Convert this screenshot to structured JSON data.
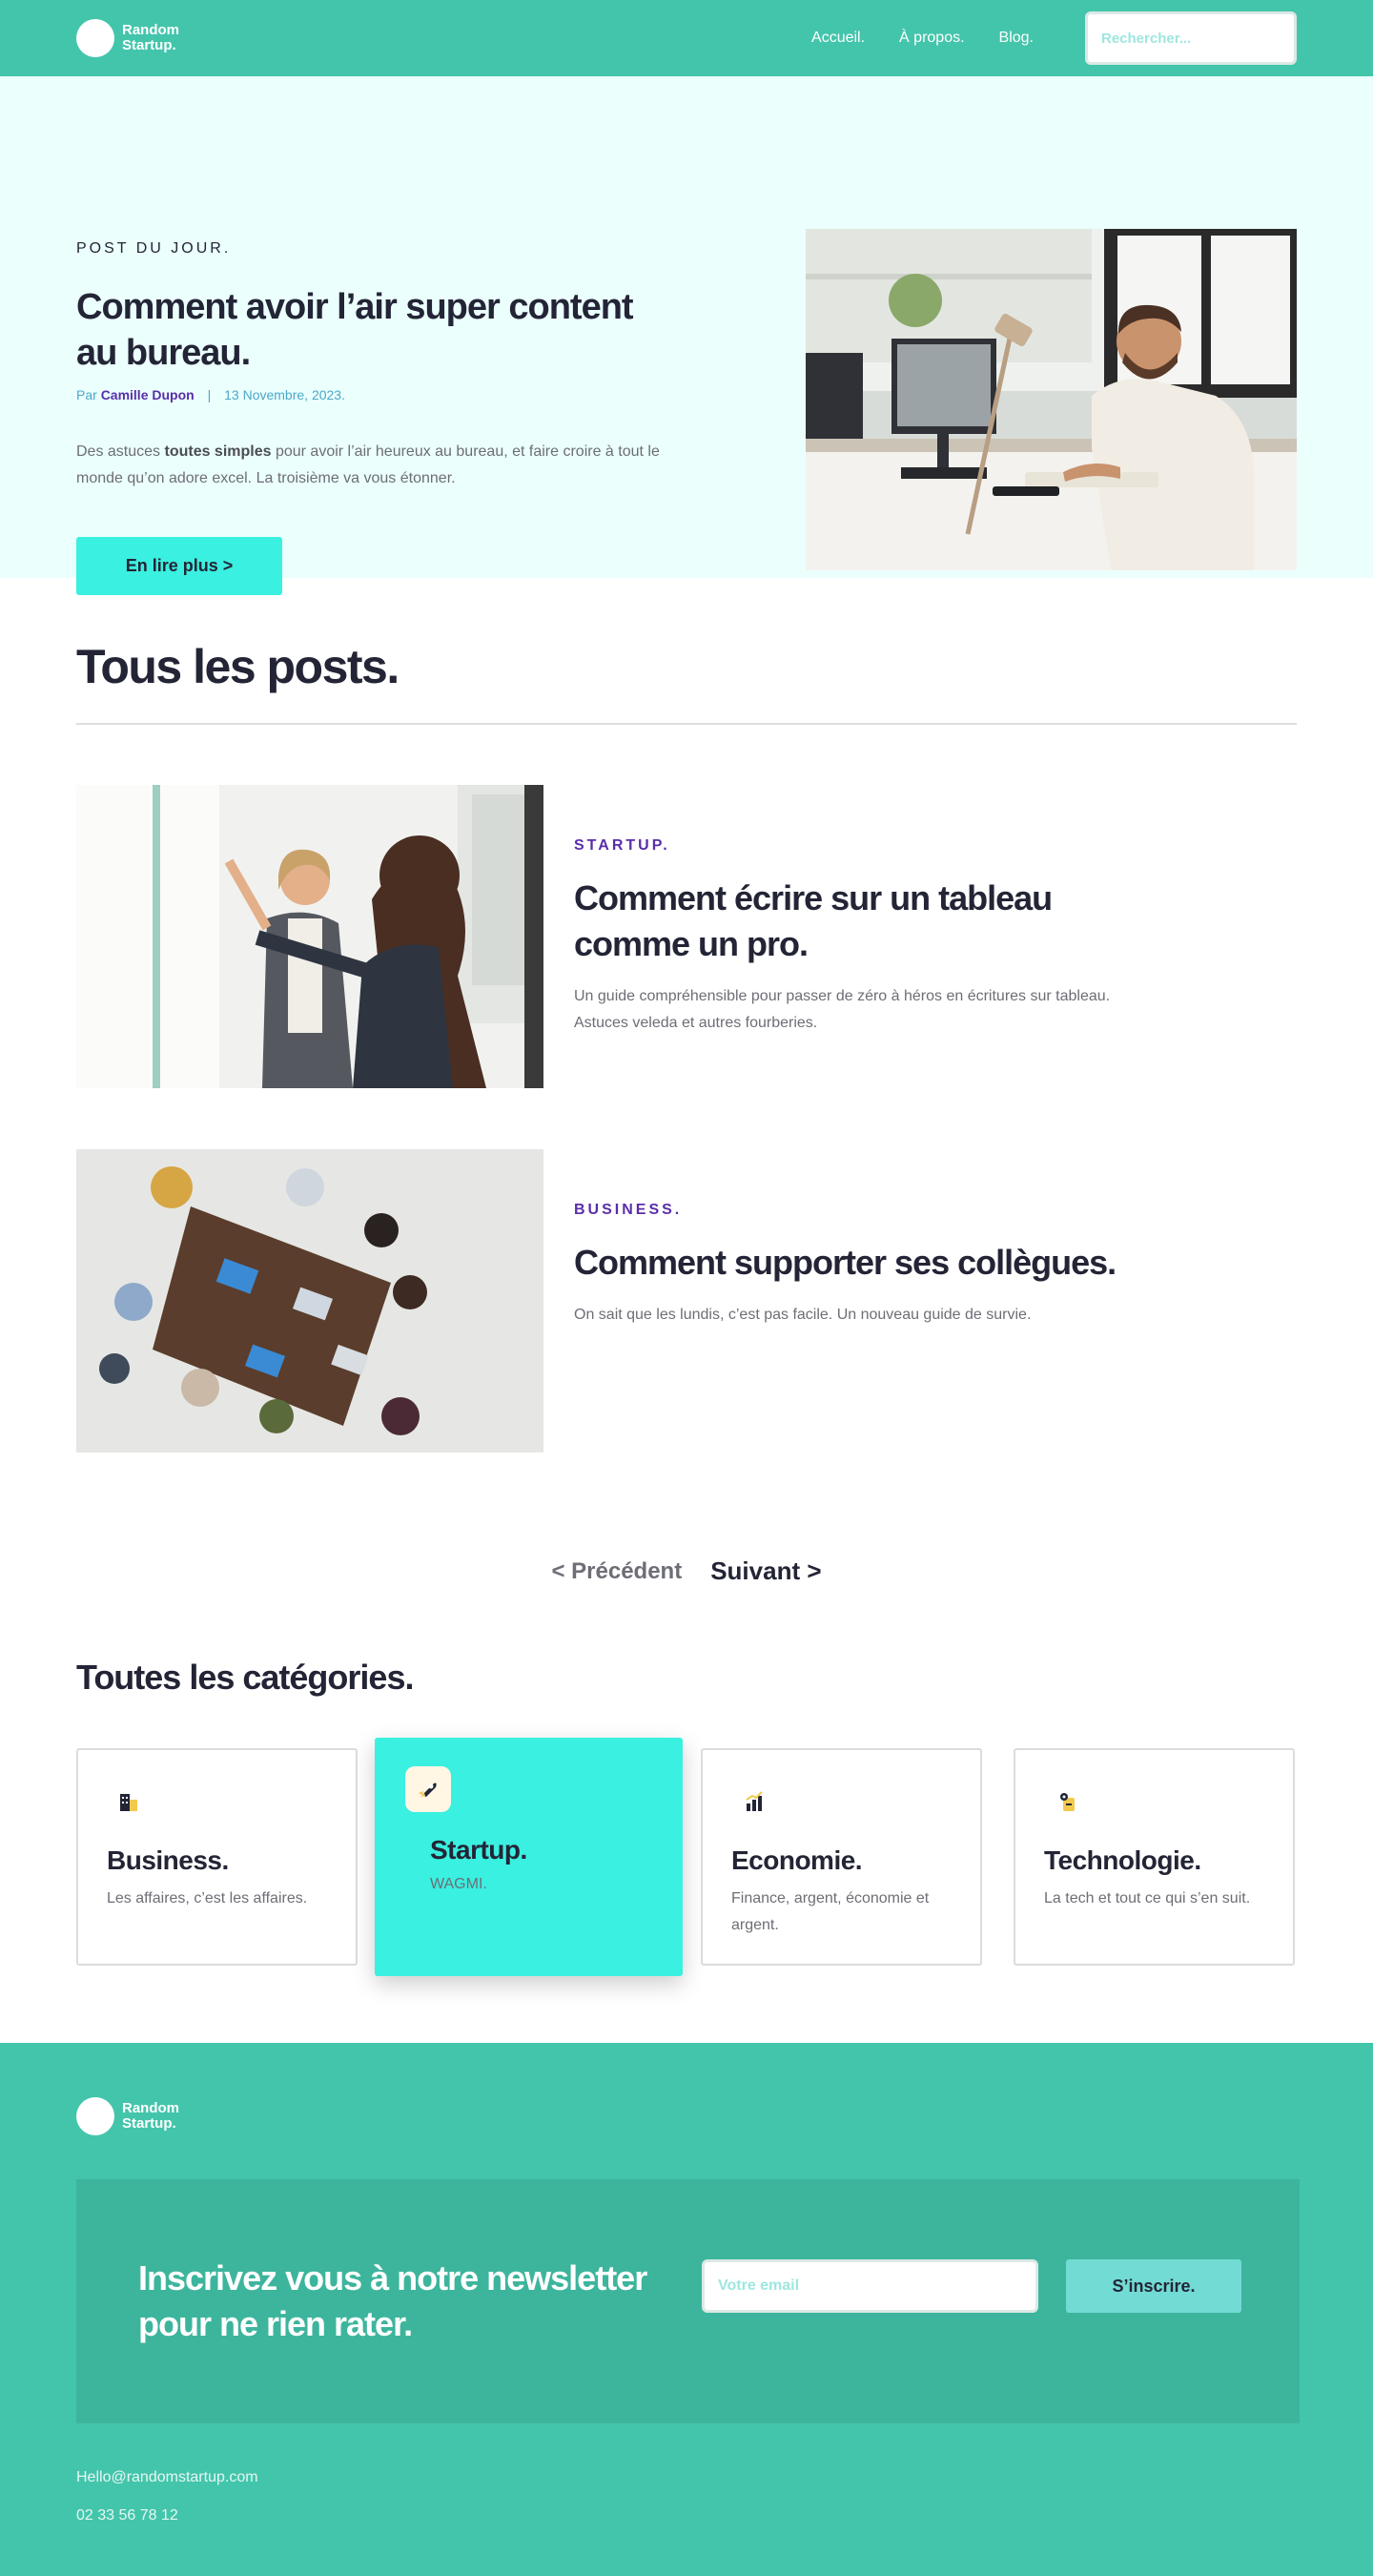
{
  "header": {
    "logo_line1": "Random",
    "logo_line2": "Startup.",
    "nav": [
      "Accueil.",
      "À propos.",
      "Blog."
    ],
    "search_placeholder": "Rechercher..."
  },
  "hero": {
    "eyebrow": "POST DU JOUR.",
    "title": "Comment avoir l’air super content au bureau.",
    "by": "Par",
    "author": "Camille Dupon",
    "sep": "|",
    "date": "13 Novembre, 2023.",
    "desc_pre": "Des astuces ",
    "desc_bold": "toutes simples",
    "desc_post": " pour avoir l’air heureux au bureau, et faire croire à tout le monde qu’on adore excel. La troisième va vous étonner.",
    "button": "En lire plus >"
  },
  "all_posts": {
    "title": "Tous les posts.",
    "posts": [
      {
        "category": "STARTUP.",
        "title": "Comment écrire sur un tableau comme un pro.",
        "desc": "Un guide compréhensible pour passer de zéro à héros en écritures sur tableau. Astuces veleda et autres fourberies."
      },
      {
        "category": "BUSINESS.",
        "title": "Comment supporter ses collègues.",
        "desc": "On sait que les lundis, c’est pas facile. Un nouveau guide de survie."
      }
    ]
  },
  "pager": {
    "prev": "< Précédent",
    "next": "Suivant >"
  },
  "categories": {
    "title": "Toutes les catégories.",
    "items": [
      {
        "name": "Business.",
        "desc": "Les affaires, c’est les affaires.",
        "icon": "building-icon"
      },
      {
        "name": "Startup.",
        "desc": "WAGMI.",
        "icon": "rocket-icon"
      },
      {
        "name": "Economie.",
        "desc": "Finance, argent, économie et argent.",
        "icon": "bar-chart-icon"
      },
      {
        "name": "Technologie.",
        "desc": "La tech et tout ce qui s’en suit.",
        "icon": "tech-icon"
      }
    ]
  },
  "footer": {
    "logo_line1": "Random",
    "logo_line2": "Startup.",
    "newsletter_title": "Inscrivez vous à notre newsletter pour ne rien rater.",
    "email_placeholder": "Votre email",
    "subscribe": "S’inscrire.",
    "email": "Hello@randomstartup.com",
    "phone": "02 33 56 78 12"
  },
  "colors": {
    "header_bg": "#43c5ab",
    "hero_bg": "#ebfffd",
    "accent_cyan": "#3af0e0",
    "category_purple": "#592ea9",
    "dark_text": "#232536"
  }
}
